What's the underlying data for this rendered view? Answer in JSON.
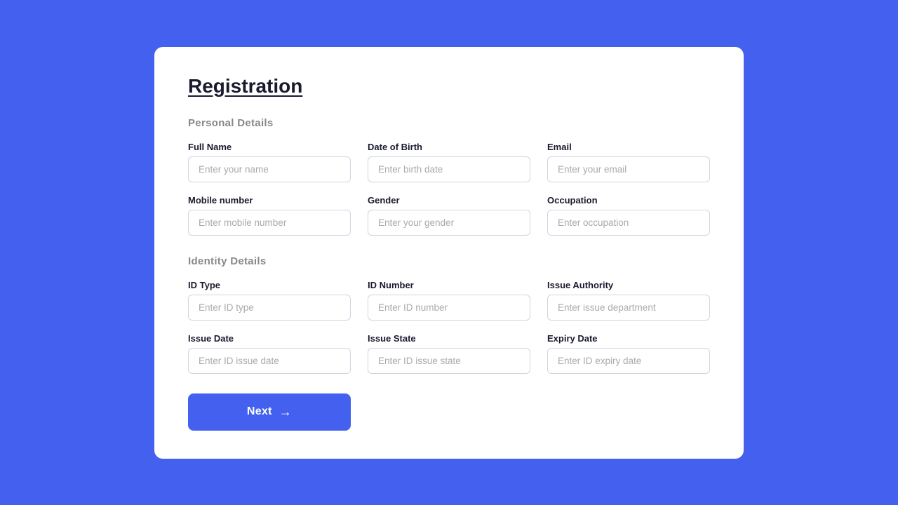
{
  "page": {
    "title": "Registration"
  },
  "sections": {
    "personal": {
      "label": "Personal Details",
      "fields": [
        {
          "id": "full-name",
          "label": "Full Name",
          "placeholder": "Enter your name"
        },
        {
          "id": "dob",
          "label": "Date of Birth",
          "placeholder": "Enter birth date"
        },
        {
          "id": "email",
          "label": "Email",
          "placeholder": "Enter your email"
        },
        {
          "id": "mobile",
          "label": "Mobile number",
          "placeholder": "Enter mobile number"
        },
        {
          "id": "gender",
          "label": "Gender",
          "placeholder": "Enter your gender"
        },
        {
          "id": "occupation",
          "label": "Occupation",
          "placeholder": "Enter occupation"
        }
      ]
    },
    "identity": {
      "label": "Identity Details",
      "fields": [
        {
          "id": "id-type",
          "label": "ID Type",
          "placeholder": "Enter ID type"
        },
        {
          "id": "id-number",
          "label": "ID Number",
          "placeholder": "Enter ID number"
        },
        {
          "id": "issue-authority",
          "label": "Issue Authority",
          "placeholder": "Enter issue department"
        },
        {
          "id": "issue-date",
          "label": "Issue Date",
          "placeholder": "Enter ID issue date"
        },
        {
          "id": "issue-state",
          "label": "Issue State",
          "placeholder": "Enter ID issue state"
        },
        {
          "id": "expiry-date",
          "label": "Expiry Date",
          "placeholder": "Enter ID expiry date"
        }
      ]
    }
  },
  "buttons": {
    "next": {
      "label": "Next",
      "arrow": "→"
    }
  }
}
